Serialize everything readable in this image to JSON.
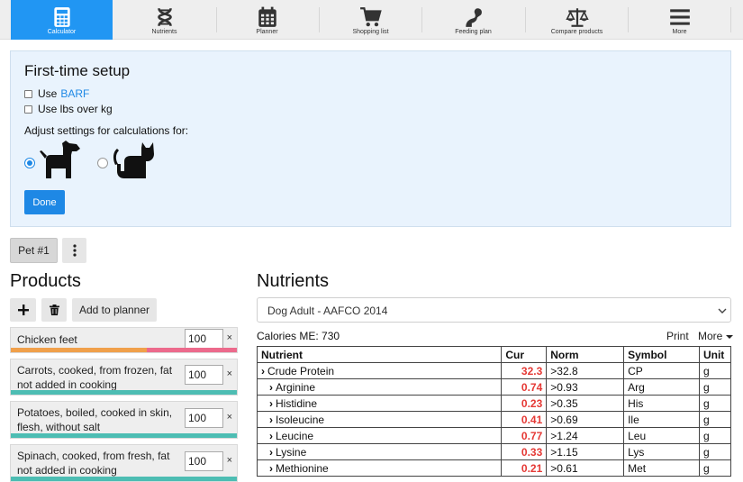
{
  "nav": [
    {
      "label": "Calculator",
      "icon": "calculator-icon",
      "active": true
    },
    {
      "label": "Nutrients",
      "icon": "dna-icon"
    },
    {
      "label": "Planner",
      "icon": "calendar-icon"
    },
    {
      "label": "Shopping list",
      "icon": "cart-icon"
    },
    {
      "label": "Feeding plan",
      "icon": "feeding-icon"
    },
    {
      "label": "Compare products",
      "icon": "scale-icon"
    },
    {
      "label": "More",
      "icon": "menu-icon"
    }
  ],
  "setup": {
    "title": "First-time setup",
    "use_prefix": "Use",
    "barf_link": "BARF",
    "lbs_label": "Use lbs over kg",
    "adjust_label": "Adjust settings for calculations for:",
    "done_label": "Done",
    "selected_species": "dog"
  },
  "pets": {
    "tab": "Pet #1"
  },
  "products": {
    "title": "Products",
    "add_to_planner": "Add to planner",
    "items": [
      {
        "name": "Chicken feet",
        "qty": "100"
      },
      {
        "name": "Carrots, cooked, from frozen, fat not added in cooking",
        "qty": "100"
      },
      {
        "name": "Potatoes, boiled, cooked in skin, flesh, without salt",
        "qty": "100"
      },
      {
        "name": "Spinach, cooked, from fresh, fat not added in cooking",
        "qty": "100"
      }
    ],
    "remove_glyph": "×"
  },
  "nutrients": {
    "title": "Nutrients",
    "profile": "Dog Adult - AAFCO 2014",
    "calories": "Calories ME: 730",
    "print": "Print",
    "more": "More",
    "headers": [
      "Nutrient",
      "Cur",
      "Norm",
      "Symbol",
      "Unit"
    ],
    "rows": [
      {
        "name": "Crude Protein",
        "cur": "32.3",
        "norm": ">32.8",
        "symbol": "CP",
        "unit": "g"
      },
      {
        "name": "Arginine",
        "cur": "0.74",
        "norm": ">0.93",
        "symbol": "Arg",
        "unit": "g"
      },
      {
        "name": "Histidine",
        "cur": "0.23",
        "norm": ">0.35",
        "symbol": "His",
        "unit": "g"
      },
      {
        "name": "Isoleucine",
        "cur": "0.41",
        "norm": ">0.69",
        "symbol": "Ile",
        "unit": "g"
      },
      {
        "name": "Leucine",
        "cur": "0.77",
        "norm": ">1.24",
        "symbol": "Leu",
        "unit": "g"
      },
      {
        "name": "Lysine",
        "cur": "0.33",
        "norm": ">1.15",
        "symbol": "Lys",
        "unit": "g"
      },
      {
        "name": "Methionine",
        "cur": "0.21",
        "norm": ">0.61",
        "symbol": "Met",
        "unit": "g"
      }
    ]
  },
  "colors": {
    "accent": "#2196f3",
    "deficit": "#e53935",
    "bar_orange": "#f0a04b",
    "bar_pink": "#ec6a8c",
    "bar_teal": "#4dbdb3"
  }
}
